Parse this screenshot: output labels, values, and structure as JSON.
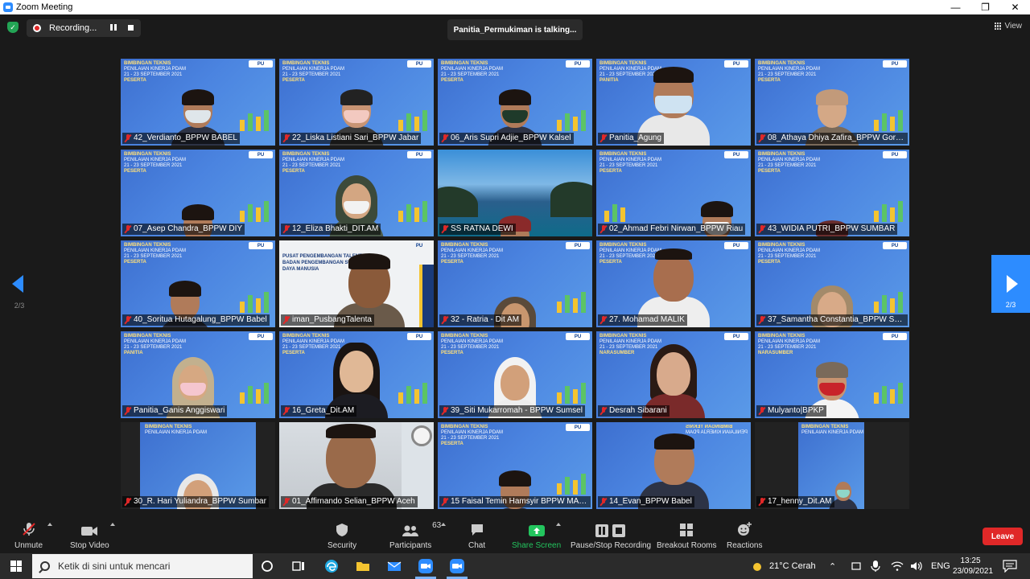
{
  "window": {
    "title": "Zoom Meeting"
  },
  "status": {
    "recording_label": "Recording...",
    "talking_label": "Panitia_Permukiman is talking...",
    "view_label": "View"
  },
  "navigation": {
    "page_indicator_left": "2/3",
    "page_indicator_right": "2/3"
  },
  "participants": [
    {
      "name": "42_Verdianto_BPPW BABEL"
    },
    {
      "name": "22_Liska Listiani Sari_BPPW Jabar"
    },
    {
      "name": "06_Aris Supri Adjie_BPPW Kalsel"
    },
    {
      "name": "Panitia_Agung"
    },
    {
      "name": "08_Athaya Dhiya Zafira_BPPW Goro..."
    },
    {
      "name": "07_Asep Chandra_BPPW DIY"
    },
    {
      "name": "12_Eliza Bhakti_DIT.AM"
    },
    {
      "name": "SS RATNA DEWI"
    },
    {
      "name": "02_Ahmad Febri Nirwan_BPPW Riau"
    },
    {
      "name": "43_WIDIA PUTRI_BPPW SUMBAR"
    },
    {
      "name": "40_Soritua Hutagalung_BPPW Babel"
    },
    {
      "name": "iman_PusbangTalenta"
    },
    {
      "name": "32 - Ratria - Dit AM"
    },
    {
      "name": "27. Mohamad MALIK"
    },
    {
      "name": "37_Samantha Constantia_BPPW Su..."
    },
    {
      "name": "Panitia_Ganis Anggiswari"
    },
    {
      "name": "16_Greta_Dit.AM"
    },
    {
      "name": "39_Siti Mukarromah - BPPW Sumsel"
    },
    {
      "name": "Desrah Sibarani"
    },
    {
      "name": "Mulyanto|BPKP"
    },
    {
      "name": "30_R. Hari Yuliandra_BPPW Sumbar"
    },
    {
      "name": "01_Affirnando Selian_BPPW Aceh"
    },
    {
      "name": "15 Faisal Temin Hamsyir BPPW MAL..."
    },
    {
      "name": "14_Evan_BPPW Babel"
    },
    {
      "name": "17_henny_Dit.AM"
    }
  ],
  "background_text": {
    "line1": "BIMBINGAN TEKNIS",
    "line2": "PENILAIAN KINERJA PDAM",
    "line3": "21 - 23 SEPTEMBER 2021",
    "role_peserta": "PESERTA",
    "role_panitia": "PANITIA",
    "role_narasumber": "NARASUMBER",
    "logo": "PU",
    "pusbang1": "PUSAT PENGEMBANGAN TALENTA",
    "pusbang2": "BADAN PENGEMBANGAN SUMBER DAYA MANUSIA"
  },
  "toolbar": {
    "unmute": "Unmute",
    "stop_video": "Stop Video",
    "security": "Security",
    "participants": "Participants",
    "participants_count": "63",
    "chat": "Chat",
    "share_screen": "Share Screen",
    "pause_stop_recording": "Pause/Stop Recording",
    "breakout_rooms": "Breakout Rooms",
    "reactions": "Reactions",
    "leave": "Leave"
  },
  "taskbar": {
    "search_placeholder": "Ketik di sini untuk mencari",
    "weather": "21°C Cerah",
    "language": "ENG",
    "time": "13:25",
    "date": "23/09/2021"
  },
  "colors": {
    "accent": "#2d8cff",
    "leave": "#e02828",
    "share_screen": "#23c55e",
    "muted_mic": "#e02828"
  }
}
